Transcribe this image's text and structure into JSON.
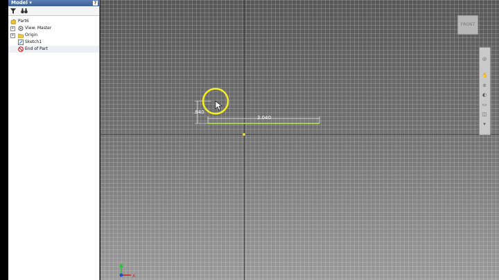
{
  "panel": {
    "title": "Model",
    "help_glyph": "?",
    "tools": {
      "filter": "filter-icon",
      "search": "binoculars-icon"
    }
  },
  "tree": [
    {
      "label": "Part6",
      "icon": "part-icon",
      "expander": ""
    },
    {
      "label": "View: Master",
      "icon": "view-icon",
      "expander": "+"
    },
    {
      "label": "Origin",
      "icon": "folder-icon",
      "expander": "+"
    },
    {
      "label": "Sketch1",
      "icon": "sketch-icon",
      "expander": ""
    },
    {
      "label": "End of Part",
      "icon": "end-of-part-icon",
      "expander": ""
    }
  ],
  "canvas": {
    "dimensions": {
      "horizontal": "3.040",
      "vertical": ".840"
    },
    "colors": {
      "sketch_line": "#b6f04a",
      "highlight_circle": "#f4ef22",
      "origin": "#e8d83a"
    }
  },
  "viewcube": {
    "label": "FRONT"
  },
  "triad": {
    "x_label": "X"
  }
}
